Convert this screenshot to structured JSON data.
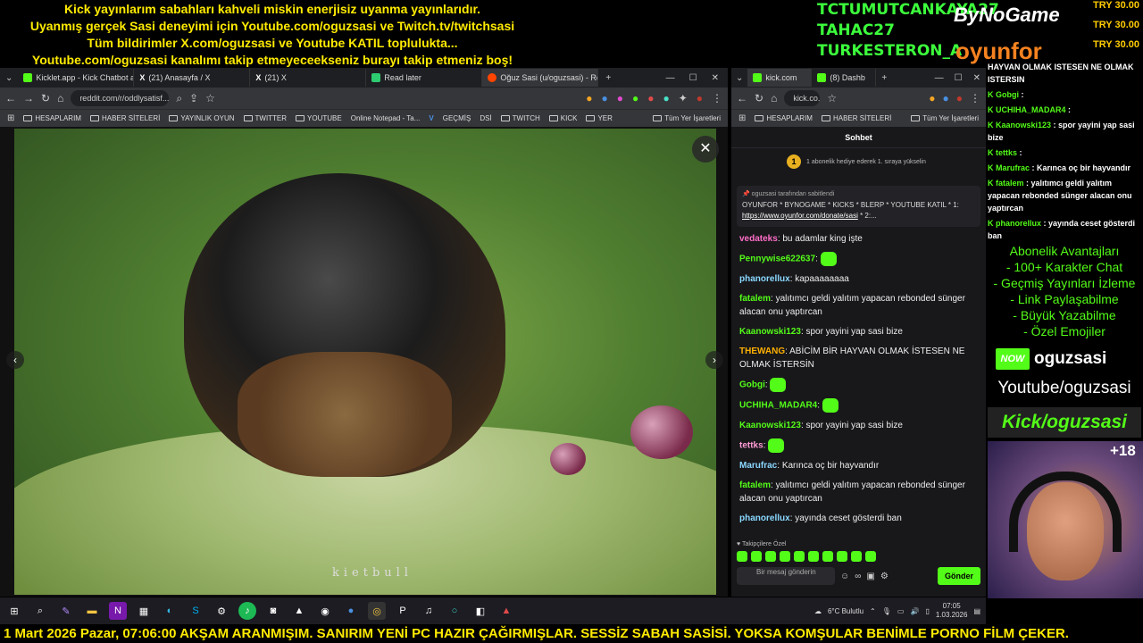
{
  "top_banner": {
    "lines": [
      "Kick yayınlarım sabahları kahveli miskin enerjisiz uyanma yayınlarıdır.",
      "Uyanmış gerçek Sasi deneyimi için Youtube.com/oguzsasi ve Twitch.tv/twitchsasi",
      "Tüm bildirimler X.com/oguzsasi ve Youtube KATIL toplulukta...",
      "Youtube.com/oguzsasi kanalımı takip etmeyeceekseniz burayı takip etmeniz boş!"
    ]
  },
  "top_mid": {
    "names": [
      "TCTUMUTCANKAYA27",
      "TAHAC27",
      "TURKESTERON_A"
    ]
  },
  "sponsors": {
    "bynogame": "ByNoGame",
    "oyunfor": "oyunfor"
  },
  "try_list": [
    "TRY 30.00",
    "TRY 30.00",
    "TRY 30.00"
  ],
  "browser1": {
    "tabs": [
      {
        "label": "Kicklet.app - Kick Chatbot and",
        "color": "#53fc18"
      },
      {
        "label": "(21) Anasayfa / X",
        "color": "#ffffff"
      },
      {
        "label": "(21) X",
        "color": "#ffffff"
      },
      {
        "label": "Read later",
        "color": "#2ecc71"
      },
      {
        "label": "Oğuz Sasi (u/oguzsasi) - Reddi",
        "color": "#ff4500"
      }
    ],
    "url": "reddit.com/r/oddlysatisf...",
    "bookmarks": [
      "HESAPLARIM",
      "HABER SİTELERİ",
      "YAYINLIK OYUN",
      "TWITTER",
      "YOUTUBE",
      "Online Notepad - Ta...",
      "V",
      "GEÇMİŞ",
      "DSİ",
      "TWITCH",
      "KICK",
      "YER",
      "Tüm Yer İşaretleri"
    ],
    "watermark": "kietbull",
    "close_label": "✕",
    "prev_label": "‹",
    "next_label": "›"
  },
  "browser2": {
    "tabs": [
      {
        "label": "kick.com",
        "color": "#53fc18"
      },
      {
        "label": "(8) Dashb",
        "color": "#53fc18"
      }
    ],
    "url": "kick.co...",
    "bookmarks": [
      "HESAPLARIM",
      "HABER SİTELERİ",
      "Tüm Yer İşaretleri"
    ],
    "chat_title": "Sohbet",
    "gift_text": "1 abonelik hediye ederek 1. sıraya yükselin",
    "gift_badge": "1",
    "pinned_by": "oguzsasi tarafından sabitlendi",
    "pinned_text": "OYUNFOR * BYNOGAME * KICKS * BLERP * YOUTUBE KATIL * 1:",
    "pinned_link": "https://www.oyunfor.com/donate/sasi",
    "pinned_tail": " * 2:...",
    "messages": [
      {
        "user": "vedateks",
        "color": "#ff6ec7",
        "text": "bu adamlar king işte"
      },
      {
        "user": "Pennywise622637",
        "color": "#53fc18",
        "text": ""
      },
      {
        "user": "phanorellux",
        "color": "#8ad8ff",
        "text": "kapaaaaaaaa"
      },
      {
        "user": "fatalem",
        "color": "#53fc18",
        "text": "yalıtımcı geldi yalıtım yapacan rebonded sünger alacan onu yaptırcan"
      },
      {
        "user": "Kaanowski123",
        "color": "#53fc18",
        "text": "spor yayini yap sasi bize"
      },
      {
        "user": "THEWANG",
        "color": "#ffb000",
        "text": "ABİCİM BİR HAYVAN OLMAK İSTESEN NE OLMAK İSTERSİN"
      },
      {
        "user": "Gobgi",
        "color": "#53fc18",
        "text": ""
      },
      {
        "user": "UCHIHA_MADAR4",
        "color": "#53fc18",
        "text": ""
      },
      {
        "user": "Kaanowski123",
        "color": "#53fc18",
        "text": "spor yayini yap sasi bize"
      },
      {
        "user": "tettks",
        "color": "#ff9ad5",
        "text": ""
      },
      {
        "user": "Marufrac",
        "color": "#8ad8ff",
        "text": "Karınca oç bir hayvandır"
      },
      {
        "user": "fatalem",
        "color": "#53fc18",
        "text": "yalıtımcı geldi yalıtım yapacan rebonded sünger alacan onu yaptırcan"
      },
      {
        "user": "phanorellux",
        "color": "#8ad8ff",
        "text": "yayında ceset gösterdi ban"
      }
    ],
    "follower_label": "Takipçilere Özel",
    "input_placeholder": "Bir mesaj gönderin",
    "send_label": "Gönder"
  },
  "right_chat": [
    {
      "user": "",
      "text": "HAYVAN OLMAK ISTESEN NE OLMAK ISTERSIN"
    },
    {
      "user": "Gobgi",
      "text": " : "
    },
    {
      "user": "UCHIHA_MADAR4",
      "text": " : "
    },
    {
      "user": "Kaanowski123",
      "text": " : spor yayini yap sasi bize"
    },
    {
      "user": "tettks",
      "text": " : "
    },
    {
      "user": "Marufrac",
      "text": " : Karınca oç bir hayvandır"
    },
    {
      "user": "fatalem",
      "text": " : yalıtımcı geldi yalıtım yapacan rebonded sünger alacan onu yaptırcan"
    },
    {
      "user": "phanorellux",
      "text": " : yayında ceset gösterdi ban"
    }
  ],
  "perks": [
    "Abonelik Avantajları",
    "- 100+ Karakter Chat",
    "- Geçmiş Yayınları İzleme",
    "- Link Paylaşabilme",
    "- Büyük Yazabilme",
    "- Özel Emojiler"
  ],
  "now_badge": "NOW",
  "channel_name": "oguzsasi",
  "youtube_handle": "Youtube/oguzsasi",
  "kick_handle": "Kick/oguzsasi",
  "age_label": "+18",
  "taskbar": {
    "weather": "6°C Bulutlu",
    "time": "07:05",
    "date": "1.03.2026",
    "icons": [
      "windows-icon",
      "search-icon",
      "pen-icon",
      "file-explorer-icon",
      "onenote-icon",
      "taskview-icon",
      "edge-icon",
      "skype-icon",
      "settings-icon",
      "spotify-icon",
      "camera-icon",
      "notepad-icon",
      "obs-icon",
      "ccleaner-icon",
      "chrome-icon",
      "terminal-icon",
      "tiktok-icon",
      "refresh-icon",
      "photos-icon",
      "game-icon"
    ]
  },
  "ticker": "1 Mart 2026 Pazar, 07:06:00  AKŞAM ARANMIŞIM. SANIRIM YENİ PC HAZIR ÇAĞIRMIŞLAR. SESSİZ SABAH SASİSİ. YOKSA KOMŞULAR BENİMLE PORNO FİLM ÇEKER."
}
